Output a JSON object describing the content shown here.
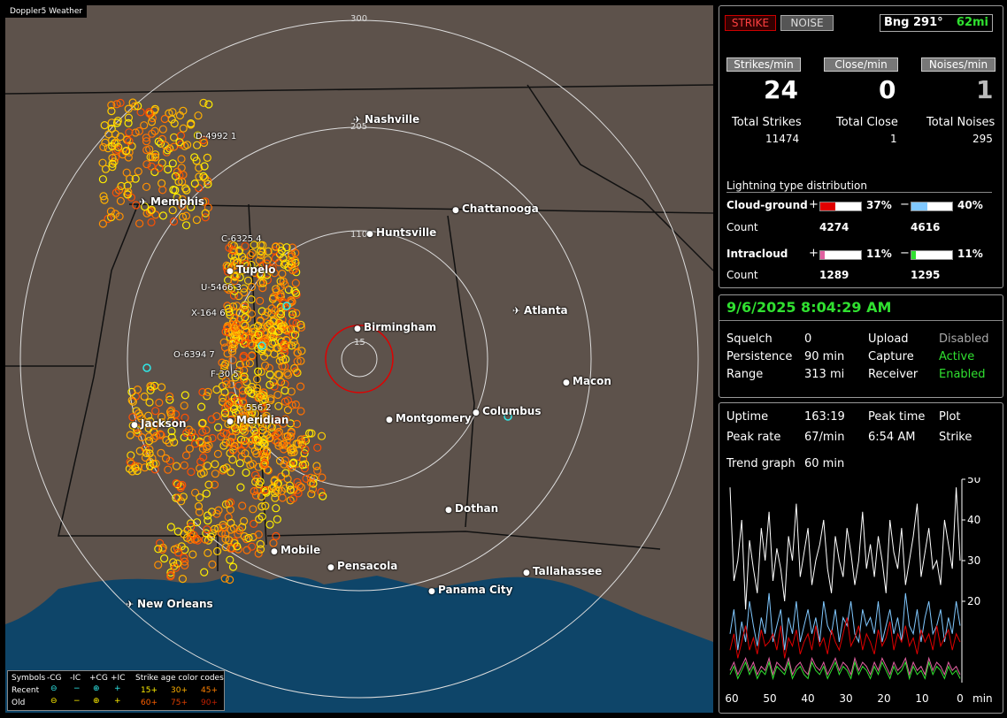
{
  "app_title": "Doppler5 Weather",
  "map": {
    "range_labels": {
      "r300": "300",
      "r205": "205",
      "r110": "110",
      "r15": "15"
    },
    "cities": [
      {
        "name": "Nashville",
        "airport": true
      },
      {
        "name": "Memphis",
        "airport": true
      },
      {
        "name": "Chattanooga",
        "airport": false
      },
      {
        "name": "Huntsville",
        "airport": false
      },
      {
        "name": "Tupelo",
        "airport": false
      },
      {
        "name": "Atlanta",
        "airport": true
      },
      {
        "name": "Birmingham",
        "airport": false
      },
      {
        "name": "Macon",
        "airport": false
      },
      {
        "name": "Jackson",
        "airport": false
      },
      {
        "name": "Meridian",
        "airport": false
      },
      {
        "name": "Montgomery",
        "airport": false
      },
      {
        "name": "Columbus",
        "airport": false
      },
      {
        "name": "Dothan",
        "airport": false
      },
      {
        "name": "Mobile",
        "airport": false
      },
      {
        "name": "Pensacola",
        "airport": false
      },
      {
        "name": "Tallahassee",
        "airport": false
      },
      {
        "name": "Panama City",
        "airport": false
      },
      {
        "name": "New Orleans",
        "airport": true
      }
    ],
    "storm_tags": [
      "D-4992 1",
      "C-6325 4",
      "U-5466 3",
      "X-164 6",
      "O-6394 7",
      "F-30 5",
      "556 2"
    ]
  },
  "legend": {
    "symbols": "Symbols",
    "cols": [
      "-CG",
      "-IC",
      "+CG",
      "+IC"
    ],
    "recent": "Recent",
    "old": "Old",
    "age_title": "Strike age color codes",
    "ages_recent": [
      "15+",
      "30+",
      "45+"
    ],
    "ages_old": [
      "60+",
      "75+",
      "90+"
    ]
  },
  "panel1": {
    "strike_btn": "STRIKE",
    "noise_btn": "NOISE",
    "bearing": "Bng 291°",
    "distance": "62mi",
    "headers": [
      "Strikes/min",
      "Close/min",
      "Noises/min"
    ],
    "big_values": [
      "24",
      "0",
      "1"
    ],
    "total_labels": [
      "Total Strikes",
      "Total Close",
      "Total Noises"
    ],
    "total_values": [
      "11474",
      "1",
      "295"
    ],
    "dist_title": "Lightning type distribution",
    "cg_label": "Cloud-ground",
    "ic_label": "Intracloud",
    "count_label": "Count",
    "cg_pos_pct": "37%",
    "cg_neg_pct": "40%",
    "cg_pos_count": "4274",
    "cg_neg_count": "4616",
    "ic_pos_pct": "11%",
    "ic_neg_pct": "11%",
    "ic_pos_count": "1289",
    "ic_neg_count": "1295",
    "plus": "+",
    "minus": "−",
    "bar_fraction": {
      "cg_pos": 0.37,
      "cg_neg": 0.4,
      "ic_pos": 0.11,
      "ic_neg": 0.11
    },
    "colors": {
      "cg_pos": "#e00000",
      "cg_neg": "#80c8ff",
      "ic_pos": "#e060a0",
      "ic_neg": "#30e030"
    }
  },
  "panel2": {
    "datetime": "9/6/2025 8:04:29 AM",
    "rows": [
      {
        "label": "Squelch",
        "value": "0",
        "label2": "Upload",
        "value2": "Disabled"
      },
      {
        "label": "Persistence",
        "value": "90 min",
        "label2": "Capture",
        "value2": "Active"
      },
      {
        "label": "Range",
        "value": "313 mi",
        "label2": "Receiver",
        "value2": "Enabled"
      }
    ]
  },
  "panel3": {
    "uptime_label": "Uptime",
    "uptime_value": "163:19",
    "peak_time_label": "Peak time",
    "plot_label": "Plot",
    "peak_rate_label": "Peak rate",
    "peak_rate_value": "67/min",
    "peak_time_value": "6:54 AM",
    "plot_value": "Strike",
    "trend_label": "Trend graph",
    "trend_value": "60 min"
  },
  "chart_data": {
    "type": "line",
    "xlabel": "min",
    "x_ticks": [
      "60",
      "50",
      "40",
      "30",
      "20",
      "10",
      "0"
    ],
    "y_ticks": [
      "50",
      "40",
      "30",
      "20"
    ],
    "ylim": [
      0,
      50
    ],
    "series": [
      {
        "color": "#ffffff",
        "values": [
          48,
          25,
          30,
          40,
          18,
          35,
          28,
          22,
          38,
          30,
          42,
          25,
          33,
          28,
          20,
          36,
          30,
          44,
          26,
          32,
          38,
          24,
          30,
          34,
          40,
          28,
          22,
          36,
          30,
          26,
          38,
          32,
          24,
          30,
          42,
          28,
          34,
          26,
          36,
          30,
          22,
          40,
          32,
          28,
          38,
          24,
          30,
          36,
          44,
          26,
          32,
          38,
          28,
          30,
          24,
          40,
          34,
          28,
          48,
          30
        ]
      },
      {
        "color": "#80c8ff",
        "values": [
          12,
          18,
          8,
          15,
          10,
          20,
          14,
          9,
          16,
          12,
          22,
          10,
          14,
          18,
          8,
          16,
          12,
          20,
          10,
          14,
          18,
          12,
          16,
          10,
          20,
          14,
          12,
          18,
          10,
          16,
          14,
          20,
          12,
          10,
          18,
          14,
          16,
          12,
          20,
          10,
          14,
          18,
          12,
          16,
          10,
          22,
          14,
          12,
          18,
          10,
          16,
          20,
          12,
          14,
          18,
          10,
          16,
          12,
          20,
          14
        ]
      },
      {
        "color": "#e00000",
        "values": [
          8,
          12,
          6,
          10,
          14,
          8,
          11,
          7,
          13,
          9,
          10,
          12,
          8,
          14,
          6,
          11,
          9,
          13,
          7,
          10,
          12,
          8,
          14,
          9,
          11,
          7,
          13,
          10,
          8,
          12,
          16,
          9,
          11,
          14,
          8,
          12,
          10,
          7,
          13,
          9,
          11,
          15,
          8,
          12,
          10,
          14,
          9,
          11,
          7,
          13,
          10,
          12,
          8,
          14,
          9,
          11,
          13,
          8,
          12,
          10
        ]
      },
      {
        "color": "#e060a0",
        "values": [
          3,
          5,
          2,
          4,
          6,
          3,
          5,
          2,
          4,
          3,
          6,
          2,
          5,
          4,
          3,
          6,
          2,
          4,
          5,
          3,
          2,
          6,
          4,
          3,
          5,
          2,
          4,
          6,
          3,
          5,
          4,
          2,
          6,
          3,
          5,
          4,
          2,
          5,
          3,
          6,
          4,
          2,
          5,
          3,
          4,
          6,
          2,
          5,
          3,
          4,
          2,
          6,
          3,
          5,
          4,
          2,
          5,
          3,
          4,
          2
        ]
      },
      {
        "color": "#30e030",
        "values": [
          2,
          4,
          1,
          3,
          5,
          2,
          4,
          1,
          3,
          2,
          5,
          1,
          4,
          3,
          2,
          5,
          1,
          3,
          4,
          2,
          1,
          5,
          3,
          2,
          4,
          1,
          3,
          5,
          2,
          4,
          3,
          1,
          5,
          2,
          4,
          3,
          1,
          4,
          2,
          5,
          3,
          1,
          4,
          2,
          3,
          5,
          1,
          4,
          2,
          3,
          1,
          5,
          2,
          4,
          3,
          1,
          4,
          2,
          3,
          1
        ]
      }
    ]
  }
}
